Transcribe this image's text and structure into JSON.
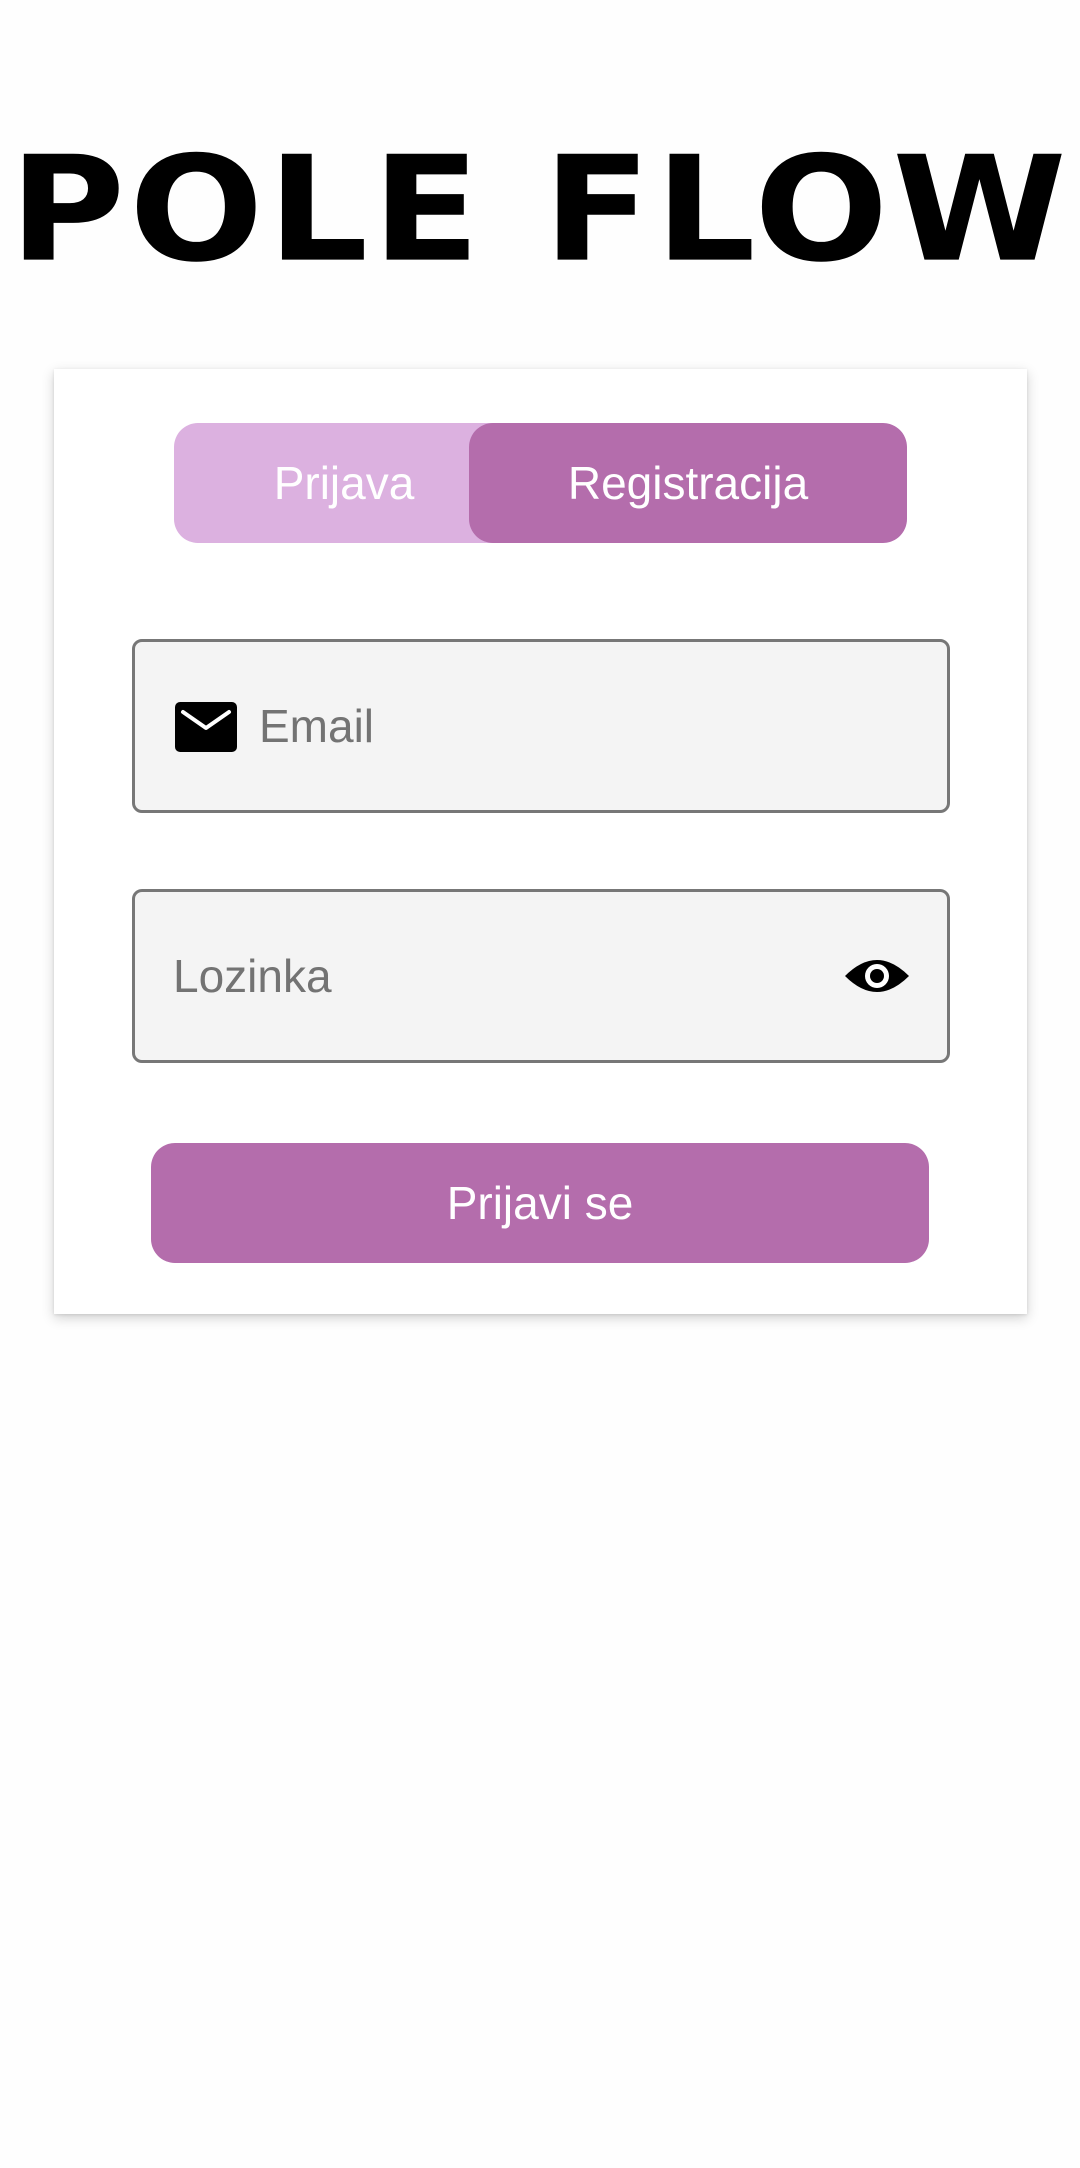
{
  "app": {
    "logo_text": "POLE FLOW"
  },
  "auth_tabs": {
    "login_label": "Prijava",
    "register_label": "Registracija",
    "active": "register"
  },
  "form": {
    "email_placeholder": "Email",
    "email_value": "",
    "password_placeholder": "Lozinka",
    "password_value": "",
    "submit_label": "Prijavi se"
  },
  "icons": {
    "email": "mail-icon",
    "password_visibility": "eye-icon"
  },
  "colors": {
    "accent": "#b46dac",
    "accent_light": "#dcb1e0",
    "field_bg": "#f4f4f4",
    "field_border": "#777777"
  }
}
